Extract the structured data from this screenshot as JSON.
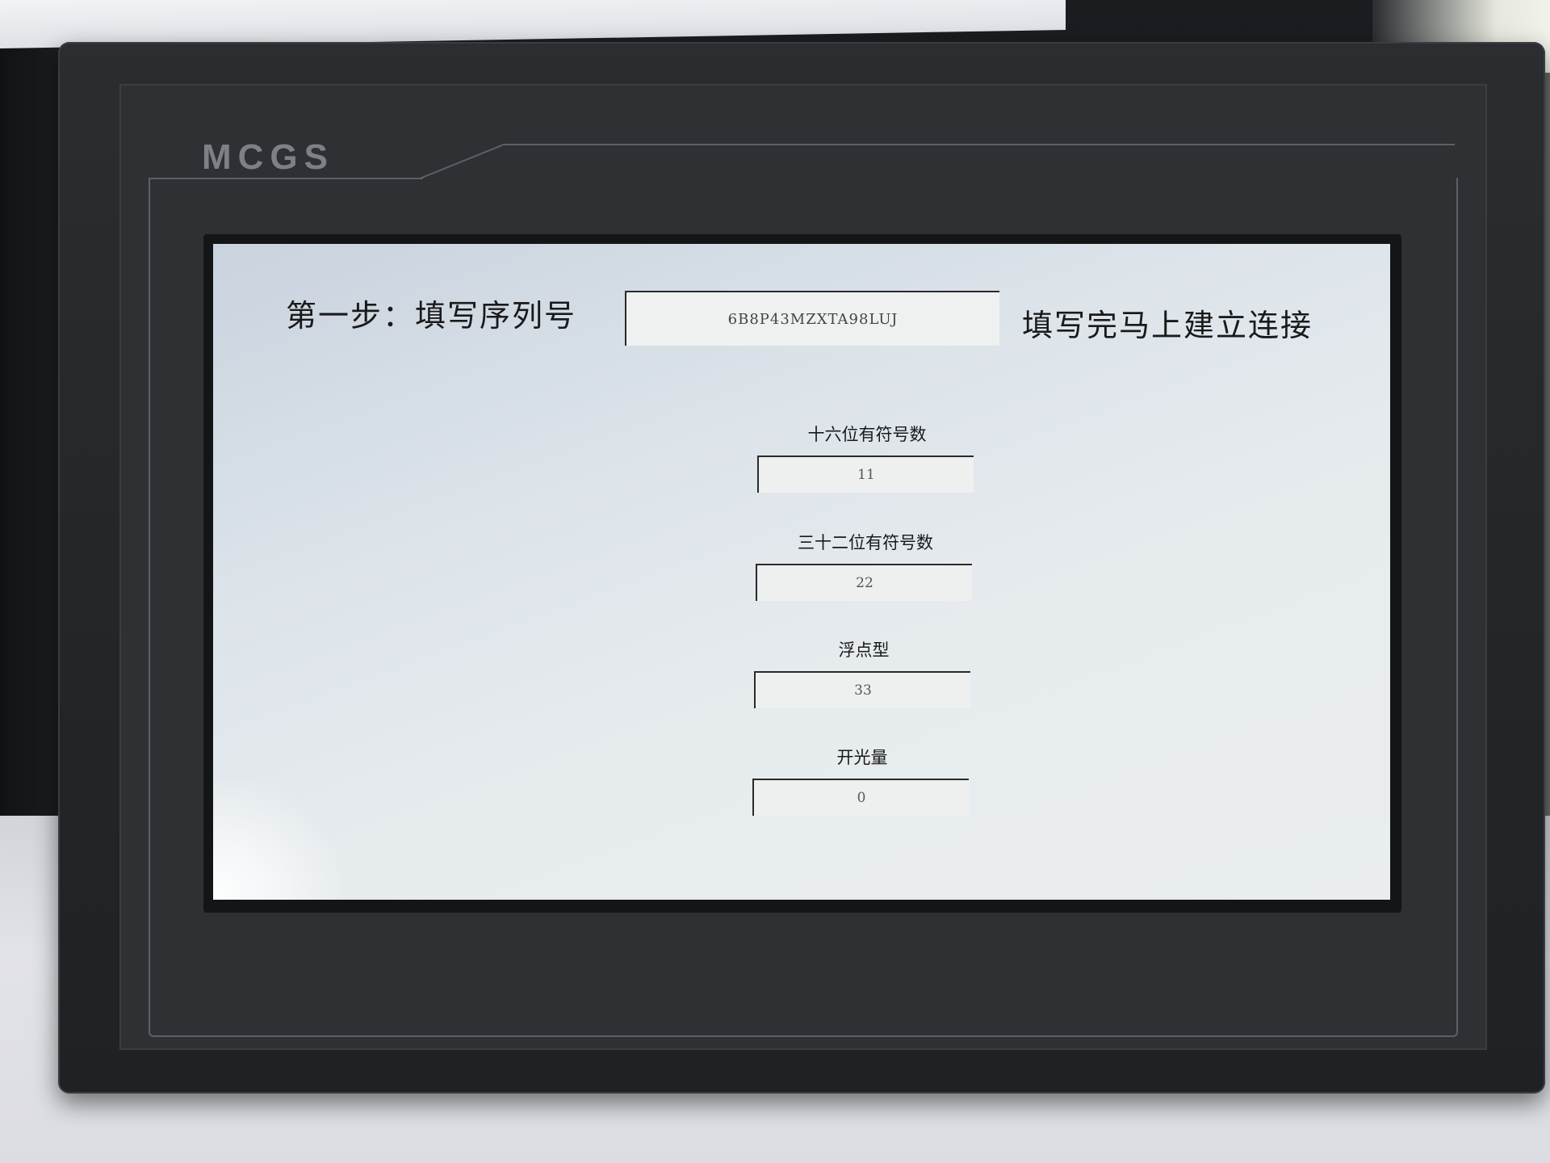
{
  "device": {
    "brand": "MCGS"
  },
  "screen": {
    "step_label": "第一步：填写序列号",
    "serial_value": "6B8P43MZXTA98LUJ",
    "connect_label": "填写完马上建立连接",
    "fields": [
      {
        "label": "十六位有符号数",
        "value": "11"
      },
      {
        "label": "三十二位有符号数",
        "value": "22"
      },
      {
        "label": "浮点型",
        "value": "33"
      },
      {
        "label": "开光量",
        "value": "0"
      }
    ]
  }
}
